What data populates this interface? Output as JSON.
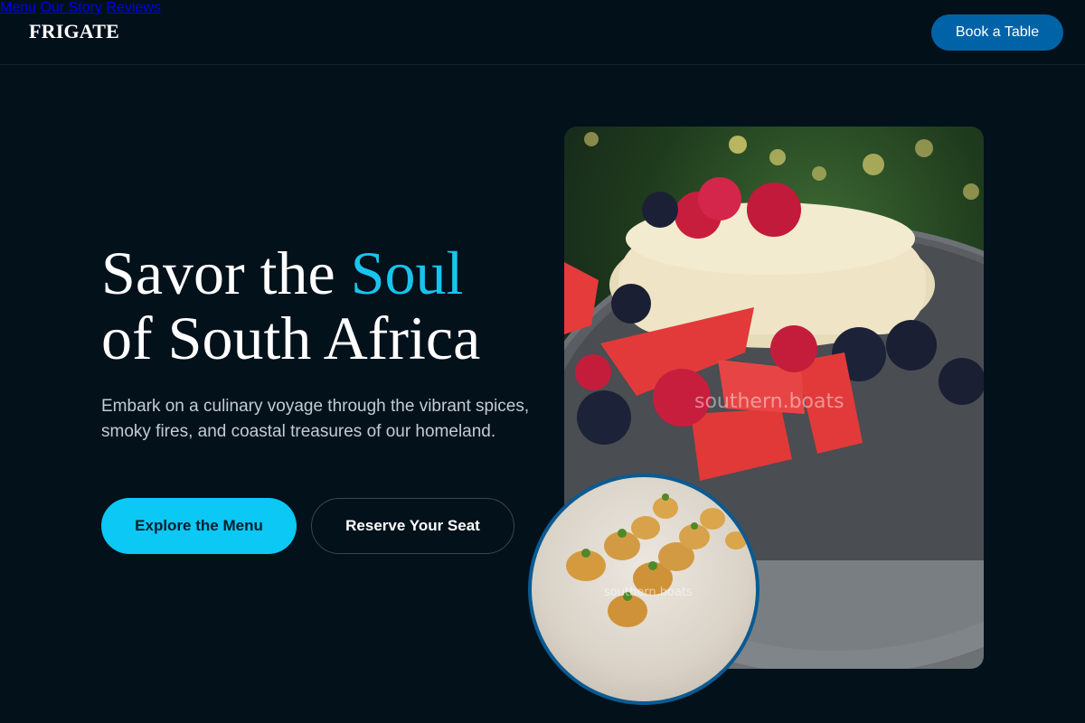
{
  "brand": {
    "logo": "FRIGATE"
  },
  "nav": {
    "items": [
      {
        "label": "Menu"
      },
      {
        "label": "Our Story"
      },
      {
        "label": "Reviews"
      }
    ],
    "cta_label": "Book a Table"
  },
  "hero": {
    "headline_part1": "Savor the ",
    "headline_accent": "Soul",
    "headline_part2": "of South Africa",
    "subtext": "Embark on a culinary voyage through the vibrant spices, smoky fires, and coastal treasures of our homeland.",
    "primary_button": "Explore the Menu",
    "secondary_button": "Reserve Your Seat"
  },
  "images": {
    "main_photo_watermark": "southern.boats",
    "round_photo_watermark": "southern.boats"
  },
  "colors": {
    "background": "#03111b",
    "accent": "#19c4ec",
    "cta": "#0063a8",
    "primary_button": "#0bc8f5"
  }
}
